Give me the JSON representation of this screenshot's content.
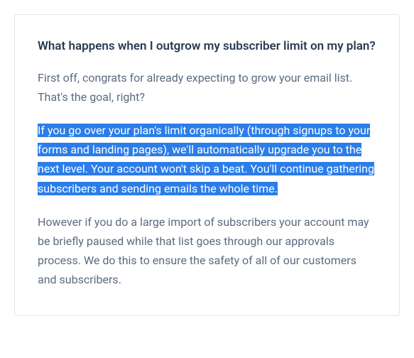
{
  "card": {
    "title": "What happens when I outgrow my subscriber limit on my plan?",
    "paragraph1": "First off, congrats for already expecting to grow your email list. That's the goal, right?",
    "paragraph2": "If you go over your plan's limit organically (through signups to your forms and landing pages), we'll automatically upgrade you to the next level. Your account won't skip a beat. You'll continue gathering subscribers and sending emails the whole time.",
    "paragraph3": "However if you do a large import of subscribers your account may be briefly paused while that list goes through our approvals process. We do this to ensure the safety of all of our customers and subscribers."
  }
}
